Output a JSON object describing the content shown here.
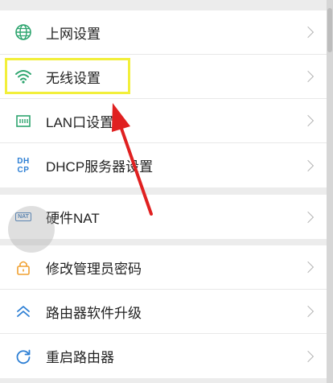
{
  "settings_group_1": [
    {
      "label": "上网设置",
      "icon": "globe-icon",
      "color": "#2ea56f"
    },
    {
      "label": "无线设置",
      "icon": "wifi-icon",
      "color": "#2ea56f"
    },
    {
      "label": "LAN口设置",
      "icon": "lan-port-icon",
      "color": "#2ea56f"
    },
    {
      "label": "DHCP服务器设置",
      "icon": "dhcp-icon",
      "icon_text": [
        "DH",
        "CP"
      ],
      "color": "#2d7fd4"
    }
  ],
  "settings_group_2": [
    {
      "label": "硬件NAT",
      "icon": "nat-icon",
      "icon_text": "NAT",
      "color": "#2d6fb5"
    }
  ],
  "settings_group_3": [
    {
      "label": "修改管理员密码",
      "icon": "lock-icon",
      "color": "#f0a030"
    },
    {
      "label": "路由器软件升级",
      "icon": "double-chevron-up-icon",
      "color": "#2d7fd4"
    },
    {
      "label": "重启路由器",
      "icon": "refresh-icon",
      "color": "#2d7fd4"
    }
  ],
  "annotation": {
    "highlight_color": "#f2ef3a",
    "arrow_color": "#e02020"
  }
}
